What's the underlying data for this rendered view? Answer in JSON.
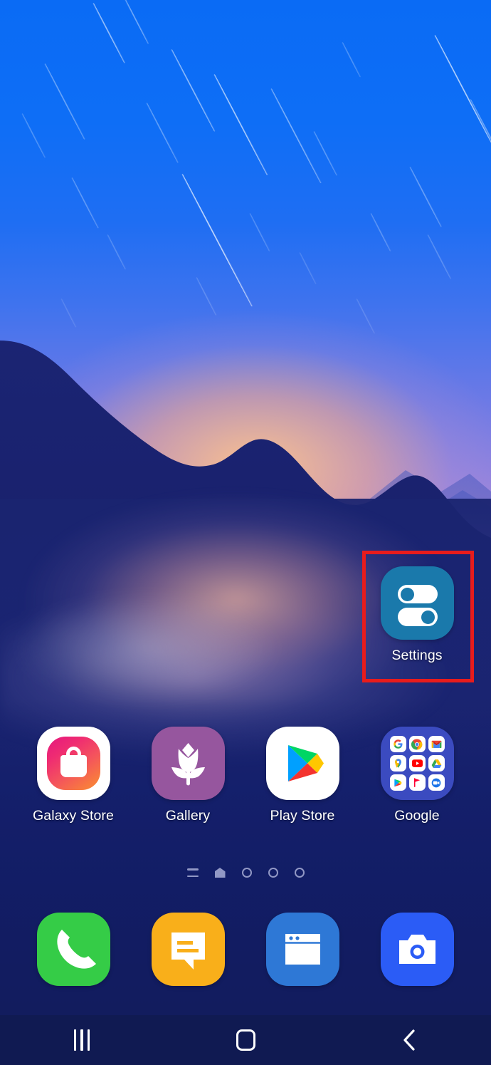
{
  "screen": {
    "device_type": "android-home-screen",
    "wallpaper_description": "Mountain lake at dusk with star trails"
  },
  "colors": {
    "sky_top": "#0a6bf5",
    "sky_glow": "#ffc48c",
    "mountain": "#16216e",
    "navbar_bg": "#101a52",
    "highlight_border": "#e81c1c",
    "label_text": "#ffffff"
  },
  "highlight": {
    "target": "Settings",
    "border_color": "#e81c1c"
  },
  "home_apps": [
    {
      "label": "Settings",
      "icon": "settings-toggles-icon",
      "icon_bg": "#1a79ab",
      "row": 0,
      "column": 3
    }
  ],
  "app_row": [
    {
      "label": "Galaxy Store",
      "icon": "galaxy-store-icon",
      "icon_bg": "#ffffff"
    },
    {
      "label": "Gallery",
      "icon": "gallery-flower-icon",
      "icon_bg": "#96569e"
    },
    {
      "label": "Play Store",
      "icon": "play-store-icon",
      "icon_bg": "#ffffff"
    },
    {
      "label": "Google",
      "icon": "google-folder-icon",
      "icon_bg": "#3b4bc0"
    }
  ],
  "google_folder_apps": [
    {
      "label": "Google",
      "icon": "google-g-icon"
    },
    {
      "label": "Chrome",
      "icon": "chrome-icon"
    },
    {
      "label": "Gmail",
      "icon": "gmail-icon"
    },
    {
      "label": "Maps",
      "icon": "maps-pin-icon"
    },
    {
      "label": "YouTube",
      "icon": "youtube-icon"
    },
    {
      "label": "Drive",
      "icon": "drive-icon"
    },
    {
      "label": "Play Store",
      "icon": "play-store-icon"
    },
    {
      "label": "YouTube Music",
      "icon": "youtube-music-icon"
    },
    {
      "label": "Duo",
      "icon": "duo-icon"
    }
  ],
  "dock": [
    {
      "label": "Phone",
      "icon": "phone-handset-icon",
      "icon_bg": "#35cc47"
    },
    {
      "label": "Messages",
      "icon": "message-bubble-icon",
      "icon_bg": "#f9af1a"
    },
    {
      "label": "Internet",
      "icon": "browser-window-icon",
      "icon_bg": "#2e78d6"
    },
    {
      "label": "Camera",
      "icon": "camera-icon",
      "icon_bg": "#2b5cf6"
    }
  ],
  "page_indicator": {
    "items": [
      {
        "type": "app-list",
        "icon": "lines-icon",
        "active": false
      },
      {
        "type": "home",
        "icon": "home-house-icon",
        "active": true
      },
      {
        "type": "page",
        "icon": "circle-icon",
        "active": false
      },
      {
        "type": "page",
        "icon": "circle-icon",
        "active": false
      },
      {
        "type": "page",
        "icon": "circle-icon",
        "active": false
      }
    ],
    "total_pages": 3,
    "current_page": 1
  },
  "navbar": [
    {
      "label": "Recents",
      "icon": "recents-bars-icon"
    },
    {
      "label": "Home",
      "icon": "home-square-icon"
    },
    {
      "label": "Back",
      "icon": "back-chevron-icon"
    }
  ]
}
